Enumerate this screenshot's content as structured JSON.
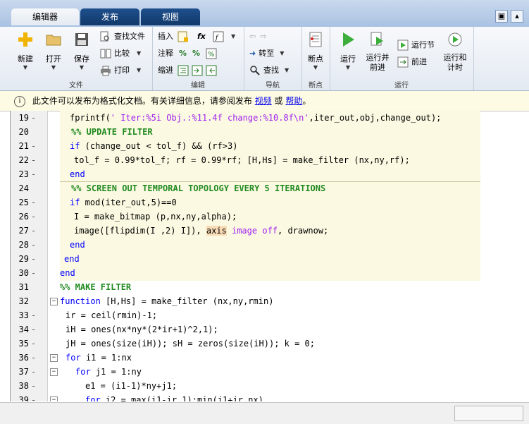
{
  "tabs": {
    "editor": "编辑器",
    "publish": "发布",
    "view": "视图"
  },
  "ribbon": {
    "file": {
      "label": "文件",
      "new": "新建",
      "open": "打开",
      "save": "保存",
      "find_files": "查找文件",
      "compare": "比较",
      "print": "打印"
    },
    "edit": {
      "label": "编辑",
      "insert": "插入",
      "comment": "注释",
      "indent": "缩进",
      "fx": "fx"
    },
    "navigate": {
      "label": "导航",
      "goto": "转至",
      "find": "查找"
    },
    "breakpoints": {
      "label": "断点",
      "breakpoint": "断点"
    },
    "run": {
      "label": "运行",
      "run": "运行",
      "run_advance": "运行并\n前进",
      "run_section": "运行节",
      "advance": "前进",
      "run_time": "运行和\n计时"
    }
  },
  "infobar": {
    "text": "此文件可以发布为格式化文档。有关详细信息，请参阅发布",
    "link1": "视频",
    "or": "或",
    "link2": "帮助",
    "end": "。"
  },
  "lines": [
    {
      "num": "19",
      "code": "fprintf(' Iter:%5i Obj.:%11.4f change:%10.8f\\n',iter_out,obj,change_out);"
    },
    {
      "num": "20",
      "code": "%% UPDATE FILTER"
    },
    {
      "num": "21",
      "code": "if (change_out < tol_f) && (rf>3)"
    },
    {
      "num": "22",
      "code": "tol_f = 0.99*tol_f; rf = 0.99*rf; [H,Hs] = make_filter (nx,ny,rf);"
    },
    {
      "num": "23",
      "code": "end"
    },
    {
      "num": "24",
      "code": "%% SCREEN OUT TEMPORAL TOPOLOGY EVERY 5 ITERATIONS"
    },
    {
      "num": "25",
      "code": "if mod(iter_out,5)==0"
    },
    {
      "num": "26",
      "code": "I = make_bitmap (p,nx,ny,alpha);"
    },
    {
      "num": "27",
      "code": "image([flipdim(I ,2) I]), axis image off, drawnow;"
    },
    {
      "num": "28",
      "code": "end"
    },
    {
      "num": "29",
      "code": "end"
    },
    {
      "num": "30",
      "code": "end"
    },
    {
      "num": "31",
      "code": "%% MAKE FILTER"
    },
    {
      "num": "32",
      "code": "function [H,Hs] = make_filter (nx,ny,rmin)"
    },
    {
      "num": "33",
      "code": "ir = ceil(rmin)-1;"
    },
    {
      "num": "34",
      "code": "iH = ones(nx*ny*(2*ir+1)^2,1);"
    },
    {
      "num": "35",
      "code": "jH = ones(size(iH)); sH = zeros(size(iH)); k = 0;"
    },
    {
      "num": "36",
      "code": "for i1 = 1:nx"
    },
    {
      "num": "37",
      "code": "for j1 = 1:ny"
    },
    {
      "num": "38",
      "code": "e1 = (i1-1)*ny+j1;"
    },
    {
      "num": "39",
      "code": "for i2 = max(i1-ir,1):min(i1+ir,nx)"
    }
  ]
}
